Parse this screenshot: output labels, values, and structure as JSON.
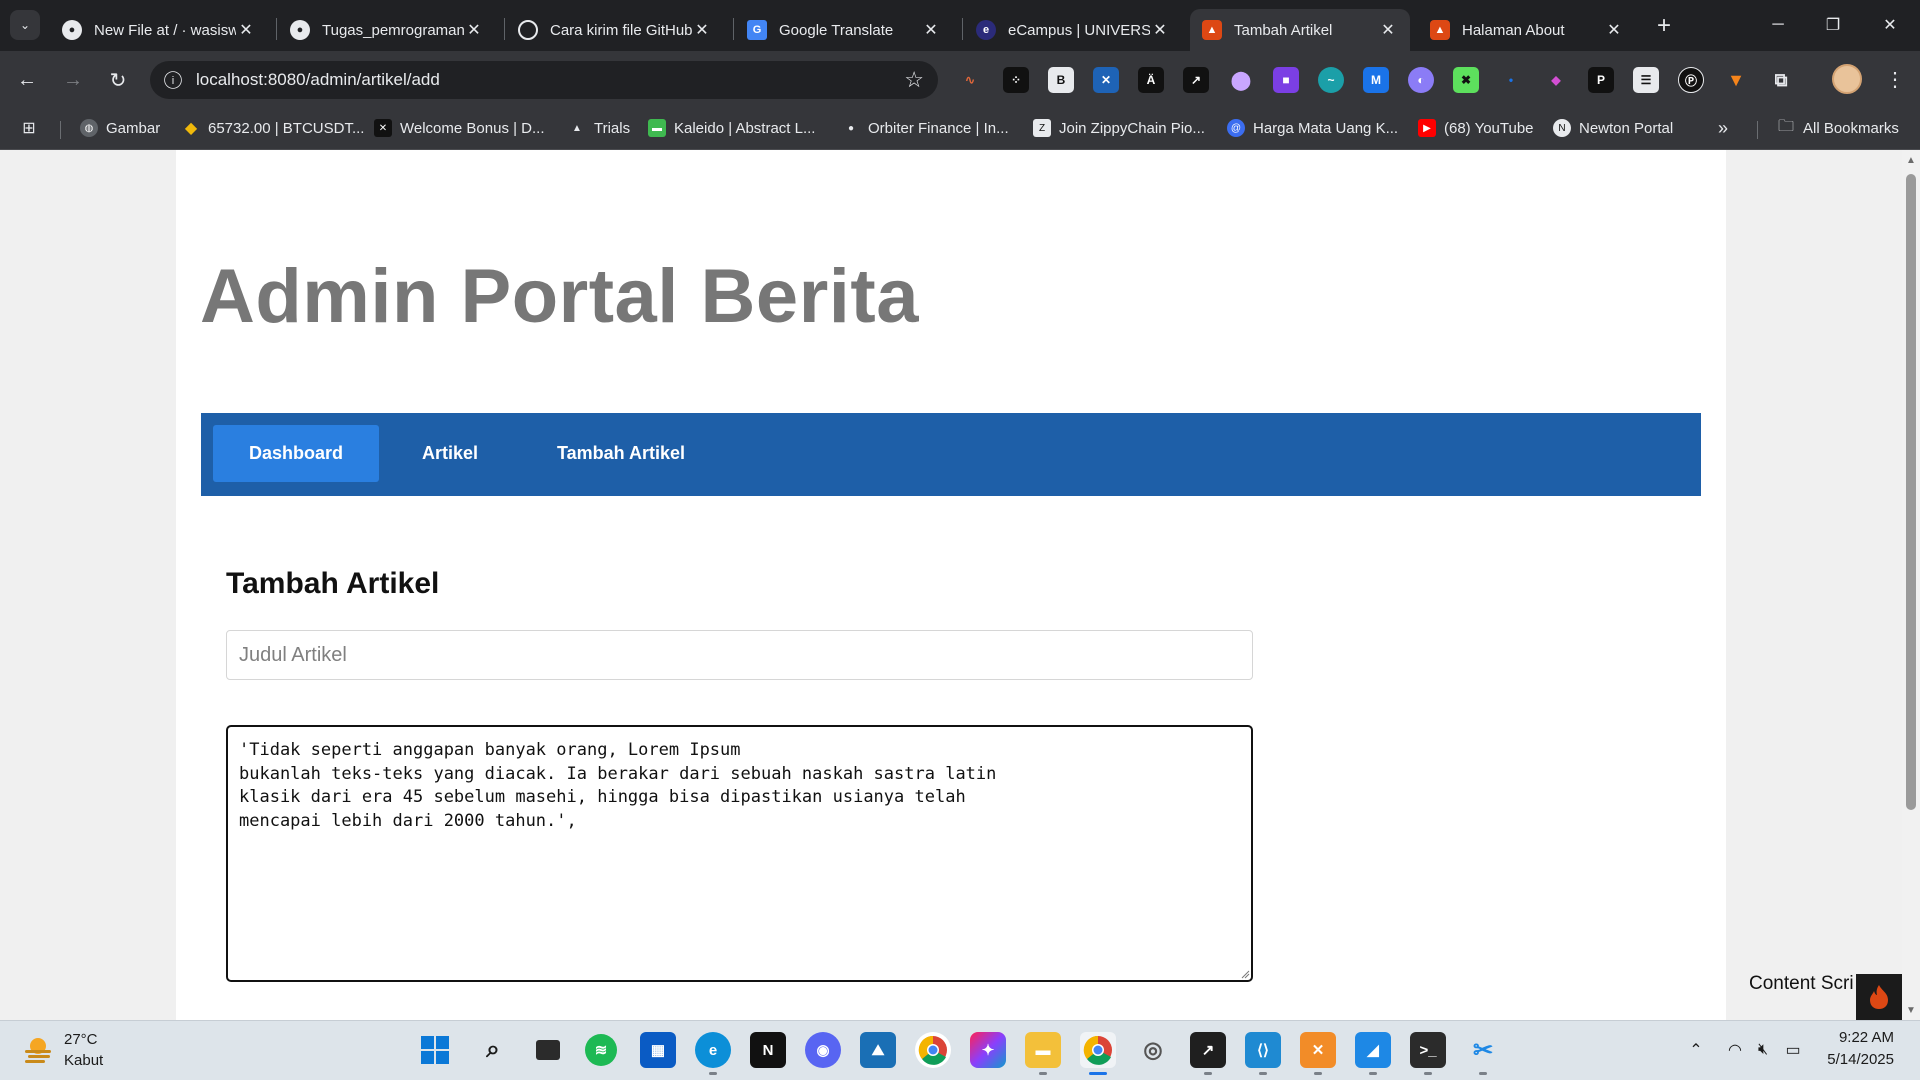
{
  "browser": {
    "tabs": [
      {
        "title": "New File at / · wasisw",
        "active": false
      },
      {
        "title": "Tugas_pemrograman_",
        "active": false
      },
      {
        "title": "Cara kirim file GitHub",
        "active": false
      },
      {
        "title": "Google Translate",
        "active": false
      },
      {
        "title": "eCampus | UNIVERSI",
        "active": false
      },
      {
        "title": "Tambah Artikel",
        "active": true
      },
      {
        "title": "Halaman About",
        "active": false
      }
    ],
    "url": "localhost:8080/admin/artikel/add",
    "bookmarks": [
      "Gambar",
      "65732.00 | BTCUSDT...",
      "Welcome Bonus | D...",
      "Trials",
      "Kaleido | Abstract L...",
      "Orbiter Finance | In...",
      "Join ZippyChain Pio...",
      "Harga Mata Uang K...",
      "(68) YouTube",
      "Newton Portal"
    ],
    "all_bookmarks_label": "All Bookmarks"
  },
  "page": {
    "site_title": "Admin Portal Berita",
    "nav": [
      {
        "label": "Dashboard",
        "active": true
      },
      {
        "label": "Artikel",
        "active": false
      },
      {
        "label": "Tambah Artikel",
        "active": false
      }
    ],
    "form": {
      "heading": "Tambah Artikel",
      "title_placeholder": "Judul Artikel",
      "title_value": "",
      "content_value": "'Tidak seperti anggapan banyak orang, Lorem Ipsum\nbukanlah teks-teks yang diacak. Ia berakar dari sebuah naskah sastra latin\nklasik dari era 45 sebelum masehi, hingga bisa dipastikan usianya telah\nmencapai lebih dari 2000 tahun.',"
    },
    "overlay_label": "Content Scri"
  },
  "taskbar": {
    "weather": {
      "temp": "27°C",
      "desc": "Kabut"
    },
    "time": "9:22 AM",
    "date": "5/14/2025"
  },
  "colors": {
    "navbar": "#1e5fa8",
    "nav_active": "#2a7fe0",
    "title_gray": "#777777",
    "chrome_dark": "#202124",
    "chrome_toolbar": "#35363a"
  }
}
